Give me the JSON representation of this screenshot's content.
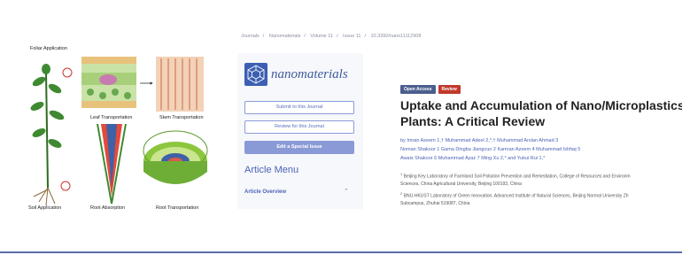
{
  "breadcrumb": [
    "Journals",
    "Nanomaterials",
    "Volume 11",
    "Issue 11",
    "10.3390/nano11112908"
  ],
  "illustration": {
    "labels": {
      "foliar": "Foliar Application",
      "leaf": "Leaf Transportation",
      "stem": "Stem Transportation",
      "soil": "Soil Application",
      "root_abs": "Root Absorption",
      "root_trans": "Root Transportation"
    }
  },
  "sidebar": {
    "logo_text": "nanomaterials",
    "submit_label": "Submit to this Journal",
    "review_label": "Review for this Journal",
    "special_issue_label": "Edit a Special Issue",
    "menu_title": "Article Menu",
    "menu_item": "Article Overview"
  },
  "article": {
    "tag_open_access": "Open Access",
    "tag_review": "Review",
    "title_line1": "Uptake and Accumulation of Nano/Microplastics in",
    "title_line2": "Plants: A Critical Review",
    "authors_line1": "by  Imran Azeem 1,†  Muhammad Adeel 2,*,†  Muhammad Arslan Ahmad 3",
    "authors_line2": "Noman Shakoor 1  Gama Dingba Jiangcuo 2  Kamran Azeem 4  Muhammad Ishfaq 5",
    "authors_line3": "Awais Shakoor 6  Muhammad Ayaz 7  Ming Xu 2,*  and  Yukui Rui 1,*",
    "affil1_num": "1",
    "affil1_line1": "Beijing Key Laboratory of Farmland Soil Pollution Prevention and Remediation, College of Resources and Environm",
    "affil1_line2": "Sciences, China Agricultural University, Beijing 100193, China",
    "affil2_num": "2",
    "affil2_line1": "BNU-HKUST Laboratory of Green Innovation, Advanced Institute of Natural Sciences, Beijing Normal University Zh",
    "affil2_line2": "Subcampus, Zhuhai 519087, China"
  },
  "colors": {
    "accent": "#4a63b6",
    "tag_review": "#c0392b",
    "tag_open_access": "#4b5e8e"
  }
}
